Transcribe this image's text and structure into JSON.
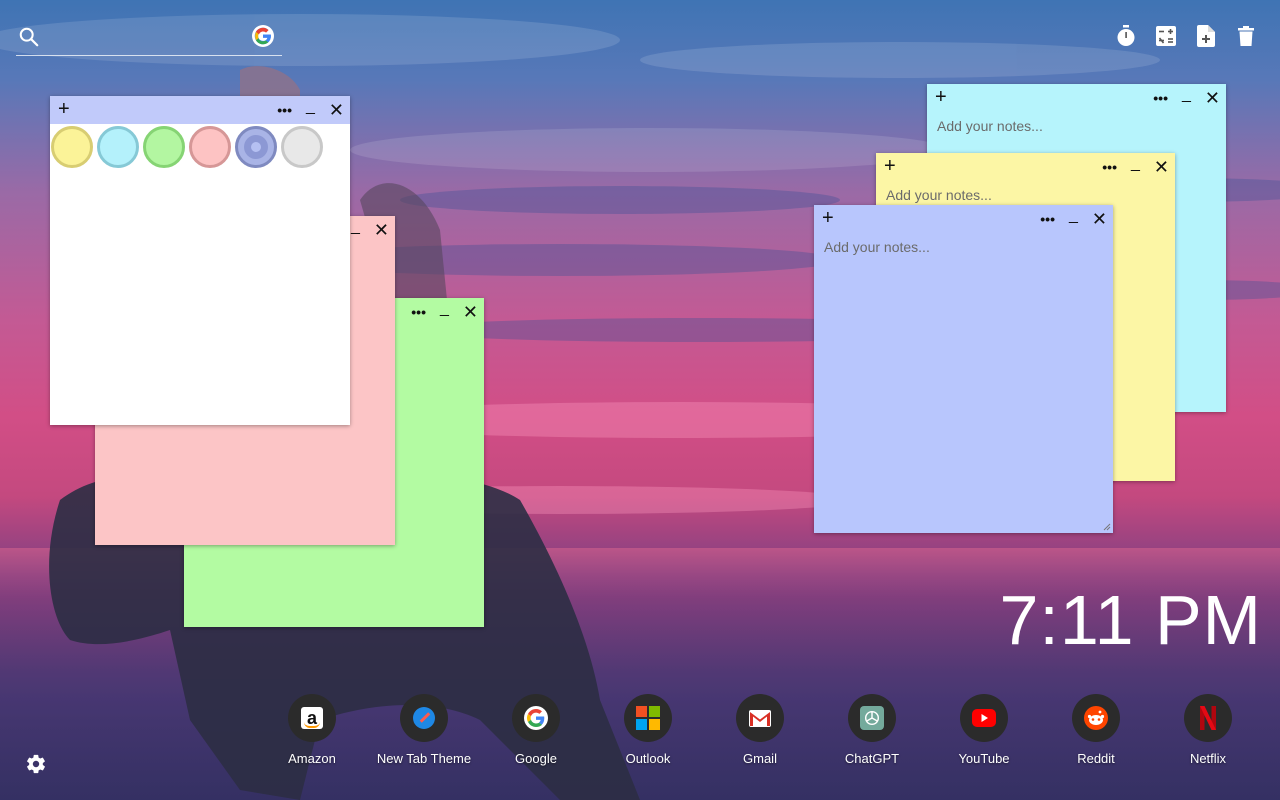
{
  "search": {
    "placeholder": ""
  },
  "tools": [
    "timer-icon",
    "calculator-icon",
    "new-note-icon",
    "trash-icon"
  ],
  "palette_note": {
    "colors": [
      "#fbf398",
      "#b4f1fb",
      "#b3f6a1",
      "#fdc3c3",
      "#a9b4e6",
      "#e8e8e8"
    ],
    "borders": [
      "#d8cd72",
      "#86c9d6",
      "#86d474",
      "#d69797",
      "#7f8ac0",
      "#c8c8c8"
    ]
  },
  "notes": {
    "pink": {
      "color": "#fcc5c6"
    },
    "green": {
      "color": "#b3fba2"
    },
    "cyan": {
      "color": "#b6f4fc",
      "placeholder": "Add your notes..."
    },
    "yellow": {
      "color": "#fcf6a5",
      "placeholder": "Add your notes..."
    },
    "blue": {
      "color": "#b8c6fd",
      "placeholder": "Add your notes..."
    }
  },
  "clock": {
    "time": "7:11 PM"
  },
  "shortcuts": [
    {
      "label": "Amazon",
      "icon": "amazon-icon"
    },
    {
      "label": "New Tab Theme",
      "icon": "new-tab-theme-icon"
    },
    {
      "label": "Google",
      "icon": "google-icon"
    },
    {
      "label": "Outlook",
      "icon": "outlook-icon"
    },
    {
      "label": "Gmail",
      "icon": "gmail-icon"
    },
    {
      "label": "ChatGPT",
      "icon": "chatgpt-icon"
    },
    {
      "label": "YouTube",
      "icon": "youtube-icon"
    },
    {
      "label": "Reddit",
      "icon": "reddit-icon"
    },
    {
      "label": "Netflix",
      "icon": "netflix-icon"
    }
  ]
}
